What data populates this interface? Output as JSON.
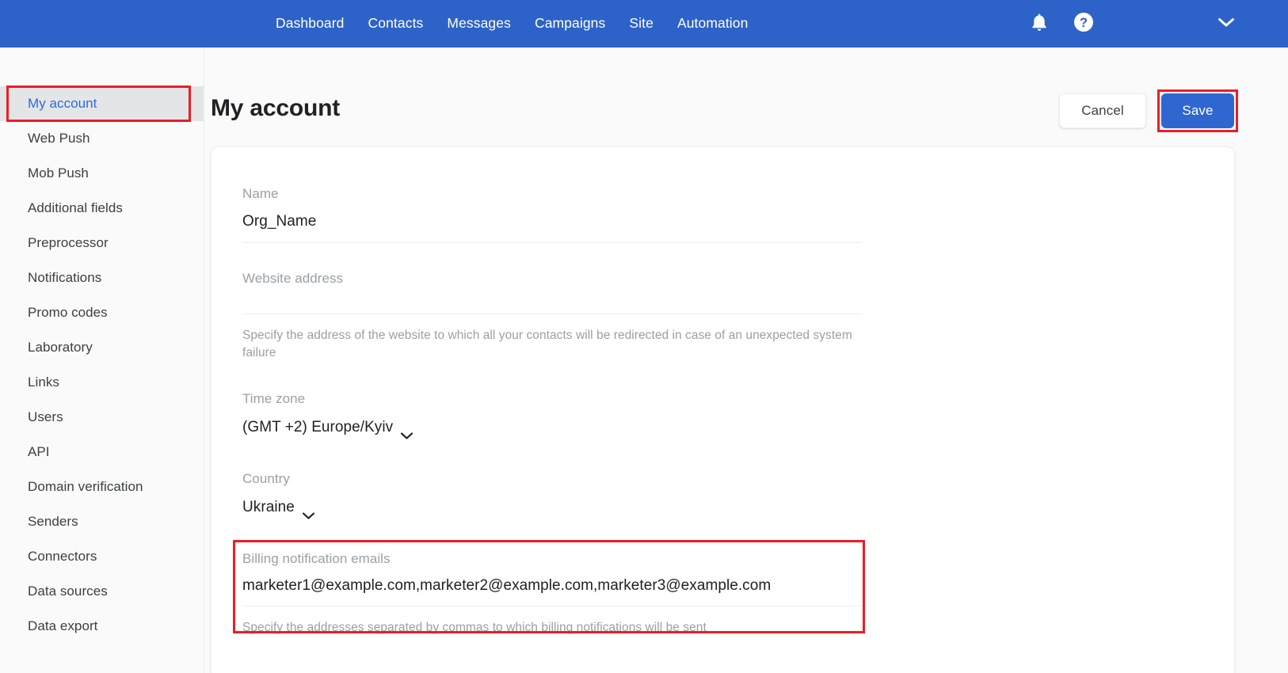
{
  "topnav": {
    "links": [
      {
        "label": "Dashboard",
        "name": "nav-dashboard"
      },
      {
        "label": "Contacts",
        "name": "nav-contacts"
      },
      {
        "label": "Messages",
        "name": "nav-messages"
      },
      {
        "label": "Campaigns",
        "name": "nav-campaigns"
      },
      {
        "label": "Site",
        "name": "nav-site"
      },
      {
        "label": "Automation",
        "name": "nav-automation"
      }
    ],
    "icons": {
      "notifications": "bell-icon",
      "help": "help-circle-icon",
      "account_menu": "chevron-down-icon"
    },
    "background_color": "#2d62c8"
  },
  "sidebar": {
    "items": [
      {
        "label": "My account",
        "active": true
      },
      {
        "label": "Web Push",
        "active": false
      },
      {
        "label": "Mob Push",
        "active": false
      },
      {
        "label": "Additional fields",
        "active": false
      },
      {
        "label": "Preprocessor",
        "active": false
      },
      {
        "label": "Notifications",
        "active": false
      },
      {
        "label": "Promo codes",
        "active": false
      },
      {
        "label": "Laboratory",
        "active": false
      },
      {
        "label": "Links",
        "active": false
      },
      {
        "label": "Users",
        "active": false
      },
      {
        "label": "API",
        "active": false
      },
      {
        "label": "Domain verification",
        "active": false
      },
      {
        "label": "Senders",
        "active": false
      },
      {
        "label": "Connectors",
        "active": false
      },
      {
        "label": "Data sources",
        "active": false
      },
      {
        "label": "Data export",
        "active": false
      }
    ],
    "active_color": "#2a6ae1",
    "active_background": "#e4e5e7"
  },
  "header": {
    "title": "My account",
    "cancel_label": "Cancel",
    "save_label": "Save",
    "save_color": "#3066d0"
  },
  "form": {
    "name": {
      "label": "Name",
      "value": "Org_Name"
    },
    "website": {
      "label": "Website address",
      "value": "",
      "hint": "Specify the address of the website to which all your contacts will be redirected in case of an unexpected system failure"
    },
    "timezone": {
      "label": "Time zone",
      "value": "(GMT +2) Europe/Kyiv"
    },
    "country": {
      "label": "Country",
      "value": "Ukraine"
    },
    "billing": {
      "label": "Billing notification emails",
      "value": "marketer1@example.com,marketer2@example.com,marketer3@example.com",
      "hint": "Specify the addresses separated by commas to which billing notifications will be sent"
    }
  },
  "annotations": {
    "color": "#ee1c25",
    "boxes": [
      "sidebar-my-account",
      "save-button",
      "billing-notification-emails-field"
    ]
  }
}
